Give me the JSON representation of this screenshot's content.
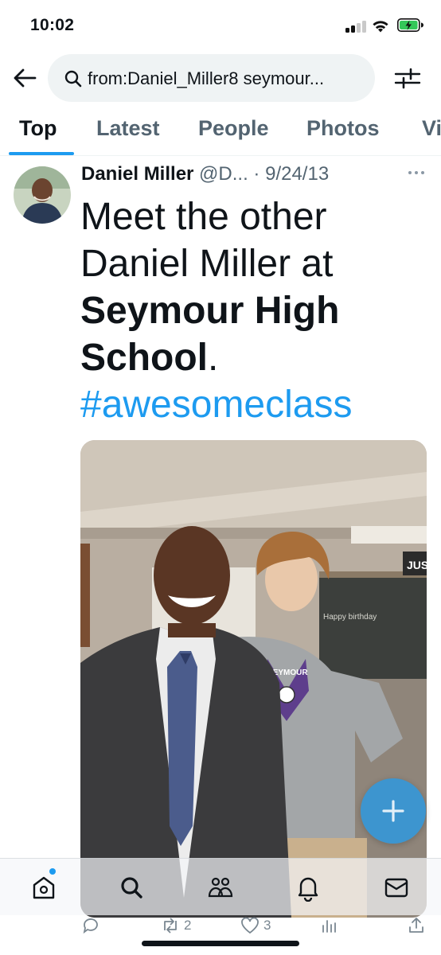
{
  "status_bar": {
    "time": "10:02",
    "battery_state": "charging"
  },
  "search": {
    "query": "from:Daniel_Miller8 seymour..."
  },
  "tabs": [
    {
      "label": "Top",
      "active": true
    },
    {
      "label": "Latest",
      "active": false
    },
    {
      "label": "People",
      "active": false
    },
    {
      "label": "Photos",
      "active": false
    },
    {
      "label": "Vi",
      "active": false
    }
  ],
  "tweet": {
    "author_name": "Daniel Miller",
    "author_handle": "@D...",
    "separator": "·",
    "date": "9/24/13",
    "text_line1": "Meet the other",
    "text_line2": "Daniel Miller at",
    "text_bold_line3": "Seymour High",
    "text_bold_line4": "School",
    "text_after_bold": ".",
    "hashtag": "#awesomeclass",
    "media": {
      "shirt_text": "SEYMOUR",
      "sign_text": "JUS",
      "board_text": "Happy birthday"
    },
    "stats": {
      "replies": "",
      "retweets": "2",
      "likes": "3"
    }
  },
  "bottom_nav": {
    "items": [
      "home-icon",
      "search-icon",
      "communities-icon",
      "notifications-icon",
      "messages-icon"
    ],
    "home_has_badge": true
  },
  "colors": {
    "accent": "#1d9bf0",
    "text_primary": "#0f1419",
    "text_secondary": "#536471"
  }
}
